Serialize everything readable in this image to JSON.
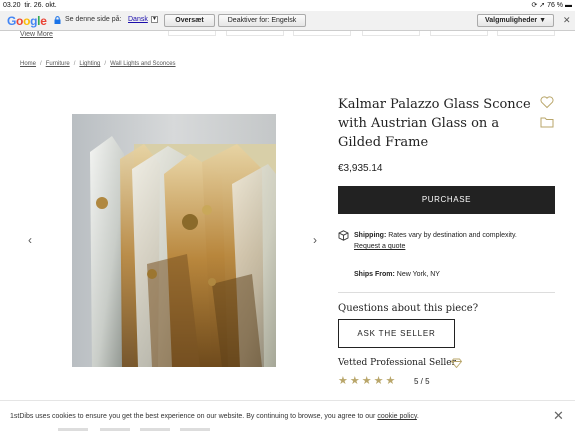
{
  "status": {
    "time": "03.20",
    "date": "tir. 26. okt.",
    "battery": "76 %"
  },
  "translate_bar": {
    "logo": [
      "G",
      "o",
      "o",
      "g",
      "l",
      "e"
    ],
    "prompt": "Se denne side på:",
    "language": "Dansk",
    "translate_button": "Oversæt",
    "disable_button": "Deaktiver for: Engelsk",
    "options_button": "Valgmuligheder ▼",
    "close": "✕"
  },
  "nav": {
    "view_more": "View More"
  },
  "breadcrumb": [
    "Home",
    "Furniture",
    "Lighting",
    "Wall Lights and Sconces"
  ],
  "product": {
    "title": "Kalmar Palazzo Glass Sconce with Austrian Glass on a Gilded Frame",
    "price": "€3,935.14",
    "purchase_label": "PURCHASE",
    "shipping_label": "Shipping:",
    "shipping_text": " Rates vary by destination and complexity.",
    "quote_link": "Request a quote",
    "ships_from_label": "Ships From:",
    "ships_from_value": " New York, NY",
    "question": "Questions about this piece?",
    "ask_label": "ASK THE SELLER",
    "vetted": "Vetted Professional Seller",
    "stars": "★★★★★",
    "rating": "5 / 5",
    "prev_arrow": "‹",
    "next_arrow": "›"
  },
  "cookie": {
    "message": "1stDibs uses cookies to ensure you get the best experience on our website. By continuing to browse, you agree to our ",
    "link": "cookie policy",
    "end": ".",
    "close": "✕"
  },
  "colors": {
    "accent_gold": "#b9a66a",
    "purchase_bg": "#222222"
  }
}
